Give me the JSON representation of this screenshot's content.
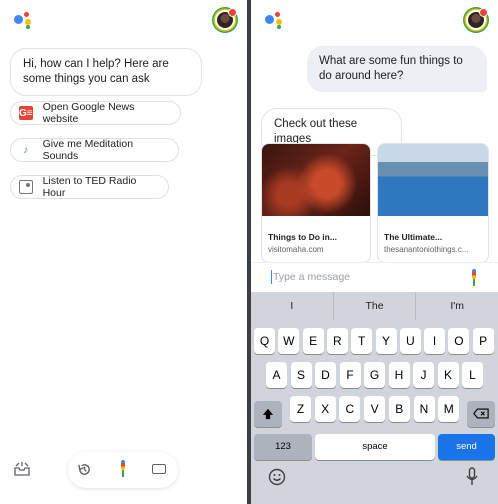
{
  "left": {
    "greeting": "Hi, how can I help? Here are some things you can ask",
    "suggestions": [
      {
        "label": "Open Google News website",
        "icon": "google-news-icon",
        "icon_text": "G≡"
      },
      {
        "label": "Give me Meditation Sounds",
        "icon": "music-note-icon",
        "icon_text": "♪"
      },
      {
        "label": "Listen to TED Radio Hour",
        "icon": "radio-icon",
        "icon_text": ""
      }
    ]
  },
  "right": {
    "user_query": "What are some fun things to do around here?",
    "reply": "Check out these images",
    "cards": [
      {
        "title": "Things to Do in...",
        "source": "visitomaha.com"
      },
      {
        "title": "The Ultimate...",
        "source": "thesanantoniothings.c..."
      }
    ],
    "input_placeholder": "Type a message",
    "keyboard": {
      "suggestions": [
        "I",
        "The",
        "I'm"
      ],
      "row1": [
        "Q",
        "W",
        "E",
        "R",
        "T",
        "Y",
        "U",
        "I",
        "O",
        "P"
      ],
      "row2": [
        "A",
        "S",
        "D",
        "F",
        "G",
        "H",
        "J",
        "K",
        "L"
      ],
      "row3": [
        "Z",
        "X",
        "C",
        "V",
        "B",
        "N",
        "M"
      ],
      "num_label": "123",
      "space_label": "space",
      "send_label": "send"
    }
  },
  "colors": {
    "blue": "#4285f4",
    "red": "#ea4335",
    "yellow": "#fbbc05",
    "green": "#34a853",
    "send": "#1a73e8"
  }
}
